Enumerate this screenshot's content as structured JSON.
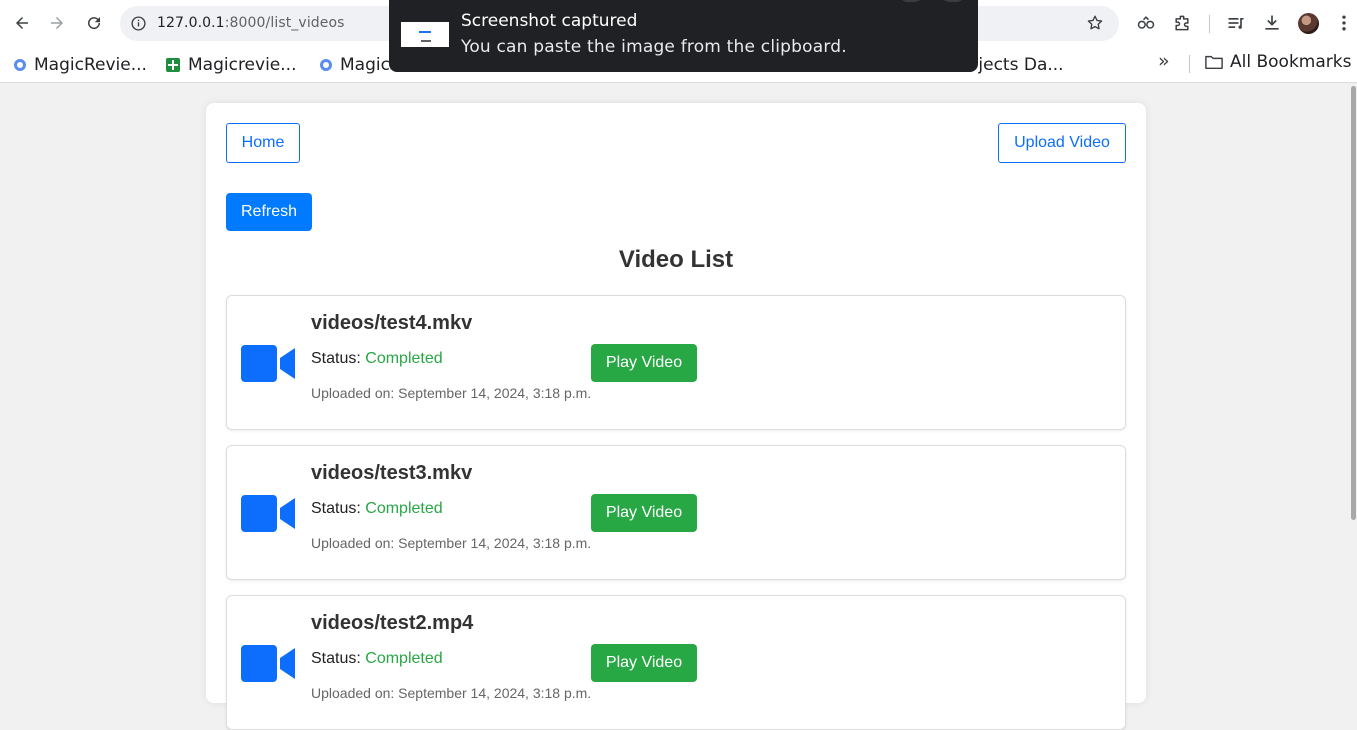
{
  "browser": {
    "url_host": "127.0.0.1",
    "url_rest": ":8000/list_videos",
    "bookmarks": [
      {
        "label": "MagicRevie...",
        "icon": "g-favicon"
      },
      {
        "label": "Magicrevie...",
        "icon": "sheets-favicon"
      },
      {
        "label": "Magic",
        "icon": "g-favicon"
      },
      {
        "label": "ojects Da...",
        "icon": "none"
      }
    ],
    "more_bookmarks": "»",
    "all_bookmarks": "All Bookmarks"
  },
  "toast": {
    "title": "Screenshot captured",
    "message": "You can paste the image from the clipboard."
  },
  "page": {
    "home_label": "Home",
    "upload_label": "Upload Video",
    "refresh_label": "Refresh",
    "title": "Video List",
    "status_prefix": "Status:",
    "play_label": "Play Video",
    "videos": [
      {
        "name": "videos/test4.mkv",
        "status": "Completed",
        "uploaded": "Uploaded on: September 14, 2024, 3:18 p.m."
      },
      {
        "name": "videos/test3.mkv",
        "status": "Completed",
        "uploaded": "Uploaded on: September 14, 2024, 3:18 p.m."
      },
      {
        "name": "videos/test2.mp4",
        "status": "Completed",
        "uploaded": "Uploaded on: September 14, 2024, 3:18 p.m."
      }
    ]
  },
  "colors": {
    "primary": "#007bff",
    "success": "#28a745",
    "video_icon": "#0d6efd"
  }
}
